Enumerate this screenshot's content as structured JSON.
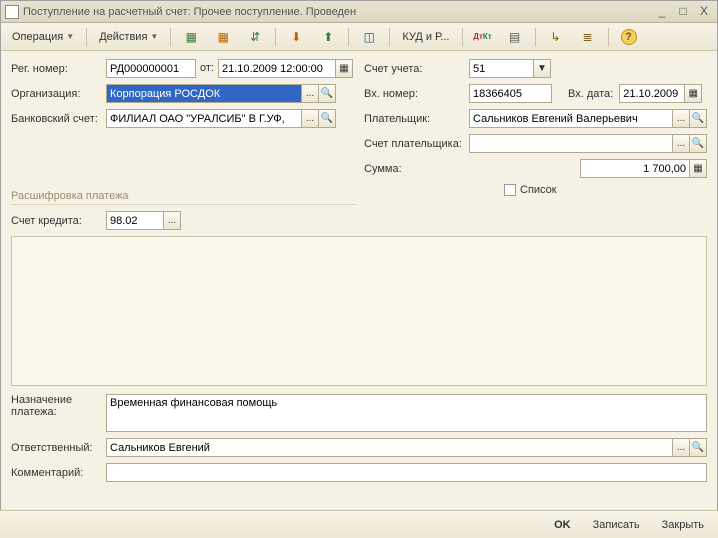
{
  "window": {
    "title": "Поступление на расчетный счет: Прочее поступление. Проведен"
  },
  "toolbar": {
    "operation": "Операция",
    "actions": "Действия",
    "kudir": "КУД и Р..."
  },
  "form": {
    "reg_number_label": "Рег. номер:",
    "reg_number": "РД000000001",
    "ot_label": "от:",
    "date": "21.10.2009 12:00:00",
    "org_label": "Организация:",
    "org": "Корпорация РОСДОК",
    "bank_label": "Банковский счет:",
    "bank": "ФИЛИАЛ ОАО \"УРАЛСИБ\" В Г.УФ,",
    "account_label": "Счет учета:",
    "account": "51",
    "in_number_label": "Вх. номер:",
    "in_number": "18366405",
    "in_date_label": "Вх. дата:",
    "in_date": "21.10.2009",
    "payer_label": "Плательщик:",
    "payer": "Сальников Евгений Валерьевич",
    "payer_account_label": "Счет плательщика:",
    "payer_account": "",
    "sum_label": "Сумма:",
    "sum": "1 700,00",
    "section_title": "Расшифровка платежа",
    "list_checkbox": "Список",
    "credit_label": "Счет кредита:",
    "credit": "98.02",
    "purpose_label1": "Назначение",
    "purpose_label2": "платежа:",
    "purpose": "Временная финансовая помощь",
    "responsible_label": "Ответственный:",
    "responsible": "Сальников Евгений",
    "comment_label": "Комментарий:",
    "comment": ""
  },
  "footer": {
    "ok": "OK",
    "save": "Записать",
    "close": "Закрыть"
  }
}
